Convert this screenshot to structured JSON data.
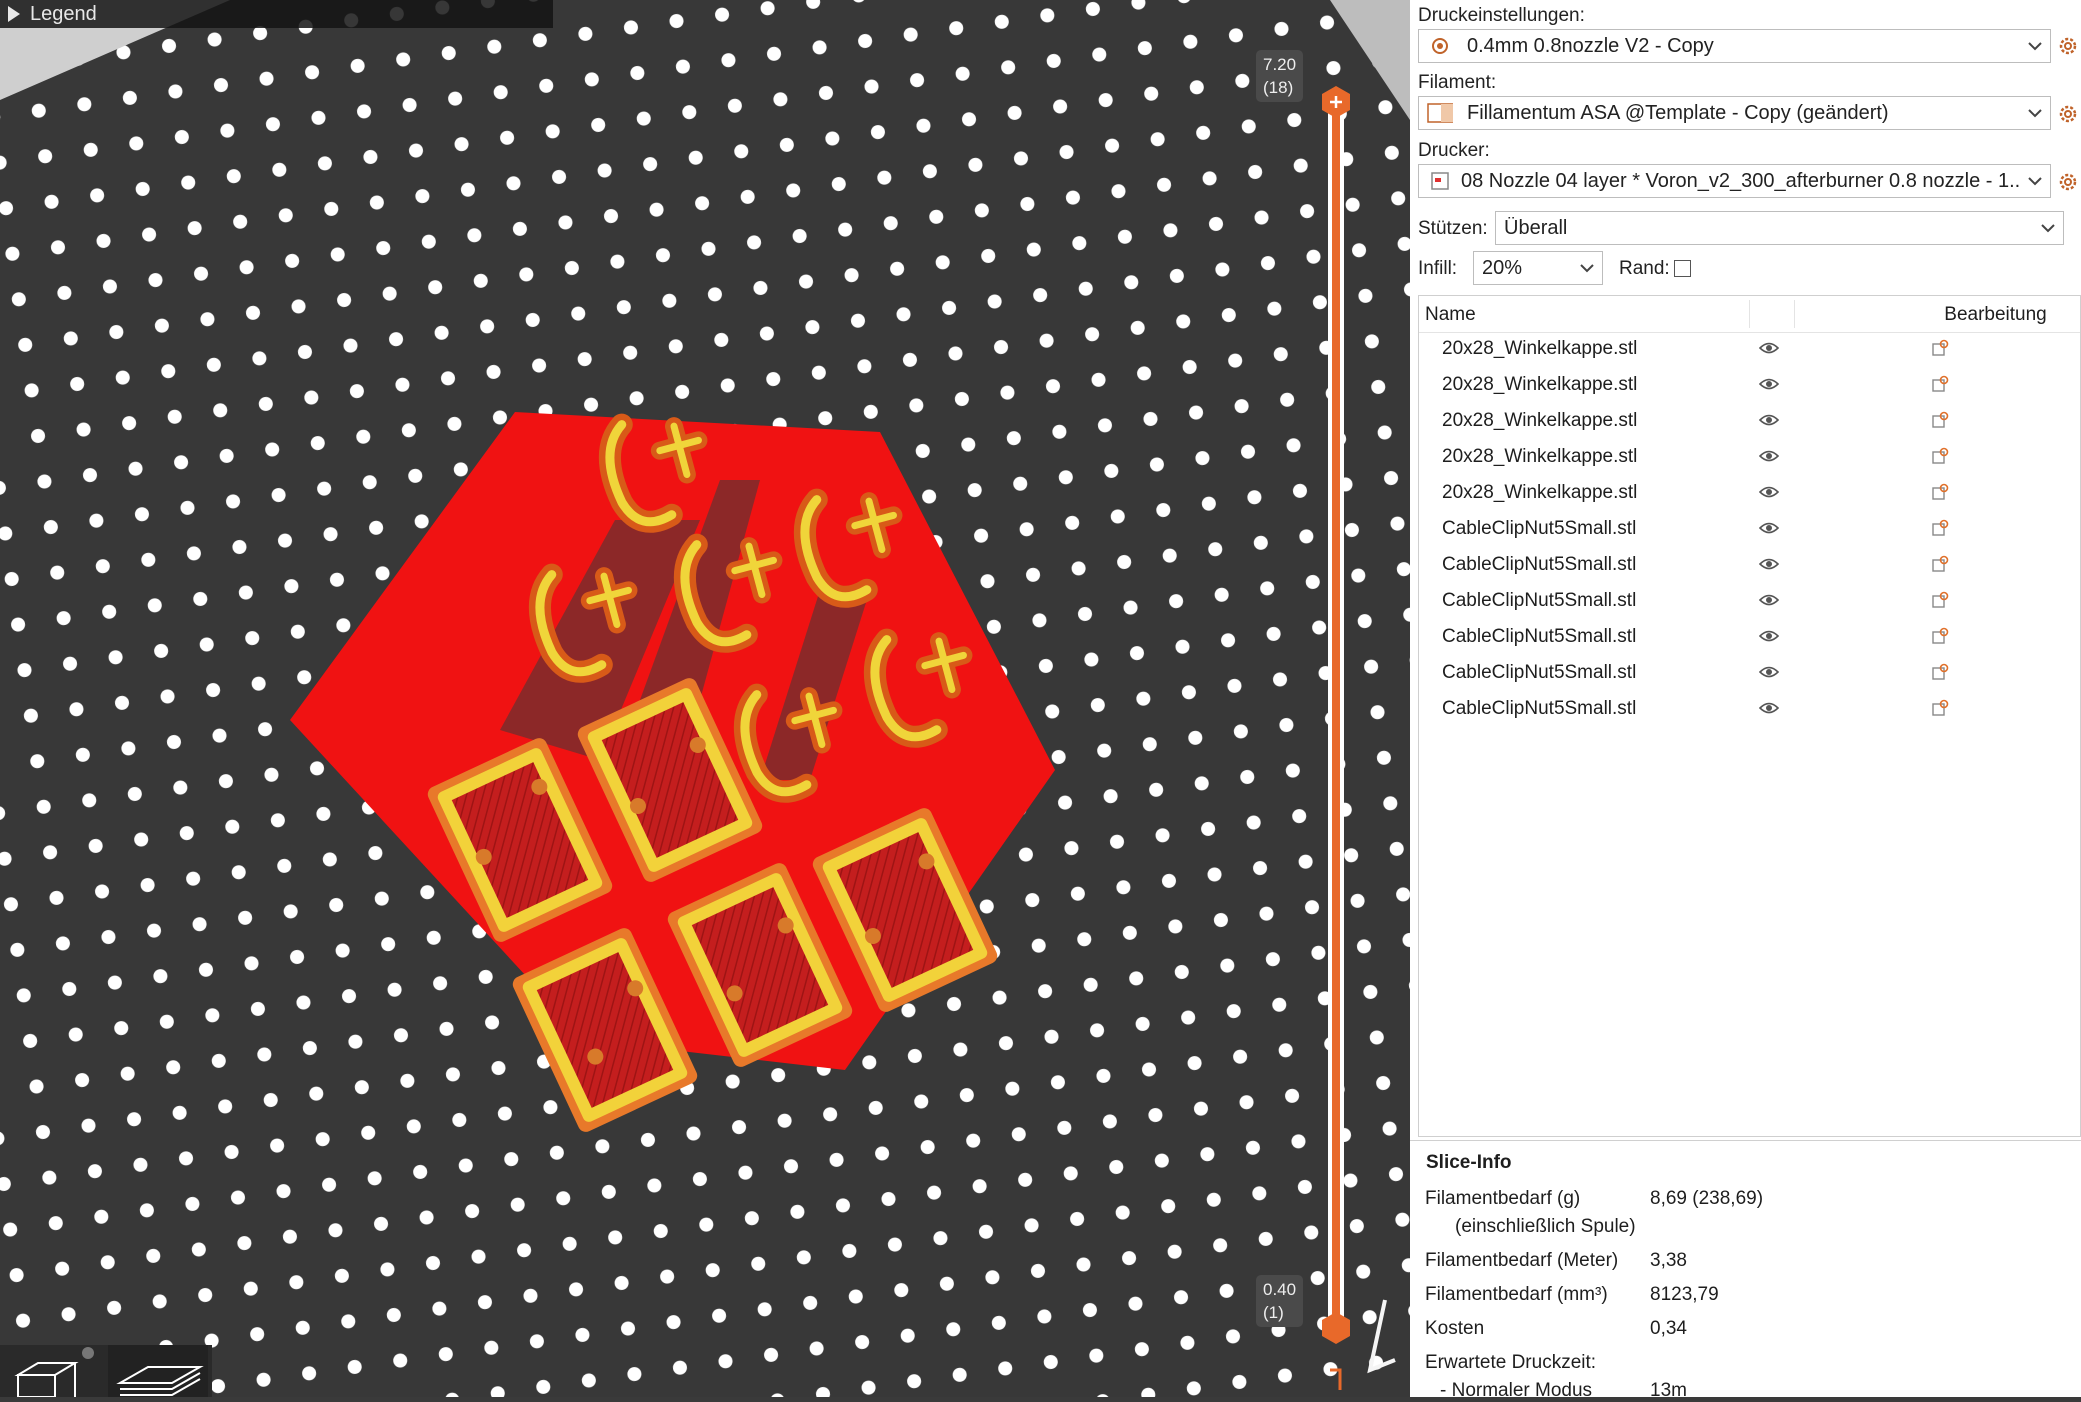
{
  "legend": {
    "label": "Legend"
  },
  "layer_slider": {
    "top_height": "7.20",
    "top_layer": "(18)",
    "bottom_height": "0.40",
    "bottom_layer": "(1)",
    "accent_color": "#e8692a"
  },
  "print_settings": {
    "label": "Druckeinstellungen:",
    "value": "0.4mm 0.8nozzle V2 - Copy"
  },
  "filament": {
    "label": "Filament:",
    "value": "Fillamentum ASA @Template - Copy (geändert)"
  },
  "printer": {
    "label": "Drucker:",
    "value": "08 Nozzle 04 layer * Voron_v2_300_afterburner 0.8 nozzle - 1..."
  },
  "supports": {
    "label": "Stützen:",
    "value": "Überall"
  },
  "infill": {
    "label": "Infill:",
    "value": "20%"
  },
  "brim": {
    "label": "Rand:",
    "checked": false
  },
  "object_list": {
    "col_name": "Name",
    "col_edit": "Bearbeitung",
    "items": [
      "20x28_Winkelkappe.stl",
      "20x28_Winkelkappe.stl",
      "20x28_Winkelkappe.stl",
      "20x28_Winkelkappe.stl",
      "20x28_Winkelkappe.stl",
      "CableClipNut5Small.stl",
      "CableClipNut5Small.stl",
      "CableClipNut5Small.stl",
      "CableClipNut5Small.stl",
      "CableClipNut5Small.stl",
      "CableClipNut5Small.stl"
    ]
  },
  "slice_info": {
    "title": "Slice-Info",
    "filament_g_label": "Filamentbedarf (g)",
    "filament_g_sub": "(einschließlich Spule)",
    "filament_g_value": "8,69 (238,69)",
    "filament_m_label": "Filamentbedarf (Meter)",
    "filament_m_value": "3,38",
    "filament_mm3_label": "Filamentbedarf (mm³)",
    "filament_mm3_value": "8123,79",
    "cost_label": "Kosten",
    "cost_value": "0,34",
    "time_label": "Erwartete Druckzeit:",
    "normal_mode_label": "- Normaler Modus",
    "normal_mode_value": "13m"
  },
  "icons": {
    "visibility": "eye-icon",
    "edit": "edit-settings-icon",
    "settings": "gear-icon",
    "dropdown": "chevron-down-icon"
  }
}
